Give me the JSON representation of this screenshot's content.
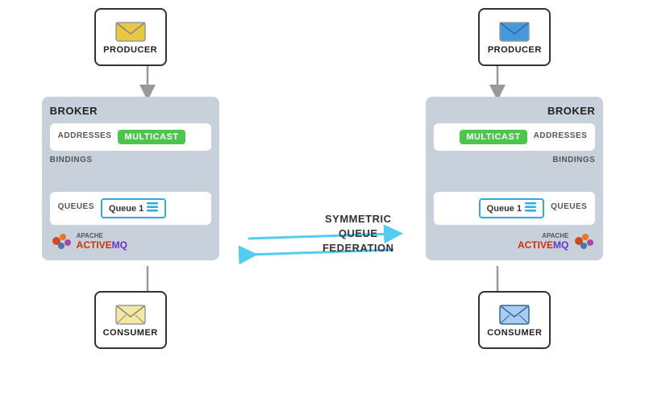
{
  "left": {
    "producer_label": "PRODUCER",
    "broker_label": "BROKER",
    "addresses_label": "ADDRESSES",
    "multicast_label": "MULTICAST",
    "bindings_label": "BINDINGS",
    "queues_label": "QUEUES",
    "queue1_label": "Queue 1",
    "consumer_label": "CONSUMER",
    "envelope_color": "#e8c840"
  },
  "right": {
    "producer_label": "PRODUCER",
    "broker_label": "BROKER",
    "addresses_label": "ADDRESSES",
    "multicast_label": "MULTICAST",
    "bindings_label": "BINDINGS",
    "queues_label": "QUEUES",
    "queue1_label": "Queue 1",
    "consumer_label": "CONSUMER",
    "envelope_color": "#4499dd"
  },
  "center": {
    "federation_label": "SYMMETRIC\nQUEUE\nFEDERATION"
  },
  "activemq": {
    "text_active": "ACTIVE",
    "text_mq": "MQ",
    "apache_label": "APACHE"
  },
  "icons": {
    "queue_lines_icon": "queue-lines-icon",
    "envelope_icon": "envelope-icon",
    "arrow_down_icon": "arrow-down-icon",
    "arrow_right_icon": "arrow-right-icon"
  }
}
